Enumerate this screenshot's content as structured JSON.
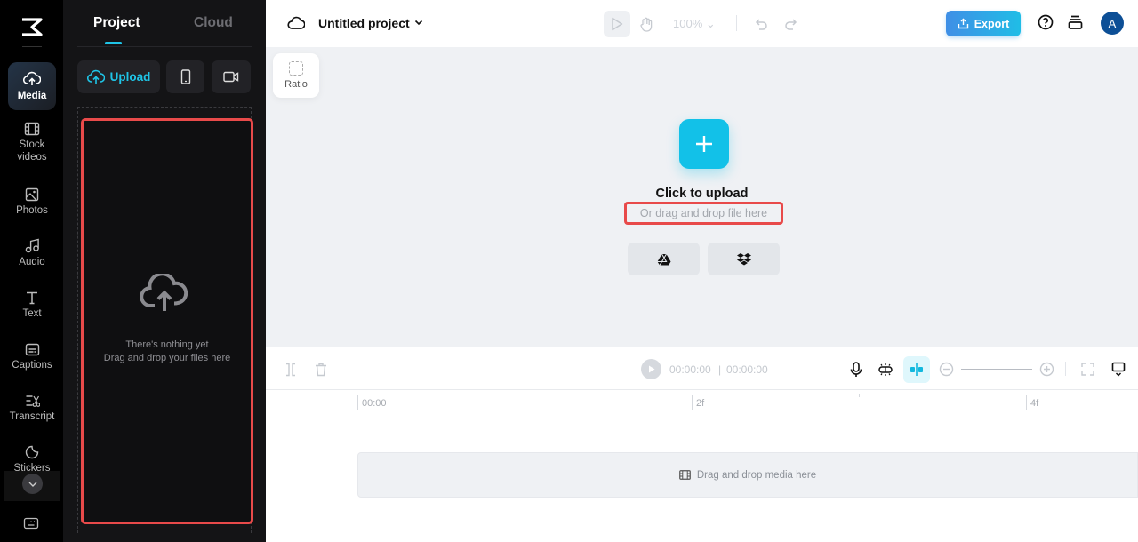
{
  "rail": {
    "items": [
      {
        "label": "Media",
        "icon": "cloud-upload-icon",
        "active": true
      },
      {
        "label": "Stock videos",
        "icon": "film-icon"
      },
      {
        "label": "Photos",
        "icon": "image-icon"
      },
      {
        "label": "Audio",
        "icon": "music-note-icon"
      },
      {
        "label": "Text",
        "icon": "text-icon"
      },
      {
        "label": "Captions",
        "icon": "captions-icon"
      },
      {
        "label": "Transcript",
        "icon": "transcript-icon"
      },
      {
        "label": "Stickers",
        "icon": "sticker-icon"
      }
    ]
  },
  "panel": {
    "tabs": [
      {
        "label": "Project",
        "active": true
      },
      {
        "label": "Cloud"
      }
    ],
    "upload_label": "Upload",
    "empty_title": "There's nothing yet",
    "empty_hint": "Drag and drop your files here"
  },
  "topbar": {
    "project_title": "Untitled project",
    "zoom_level": "100%",
    "export_label": "Export",
    "avatar_initial": "A"
  },
  "canvas": {
    "ratio_label": "Ratio",
    "click_to_upload": "Click to upload",
    "drag_hint": "Or drag and drop file here"
  },
  "timeline": {
    "current_time": "00:00:00",
    "separator": "|",
    "total_time": "00:00:00",
    "ruler_labels": [
      "00:00",
      "2f",
      "4f"
    ],
    "media_drop_hint": "Drag and drop media here"
  },
  "colors": {
    "accent": "#12c1e8",
    "highlight": "#e84a4a",
    "avatar": "#0d4f96"
  }
}
